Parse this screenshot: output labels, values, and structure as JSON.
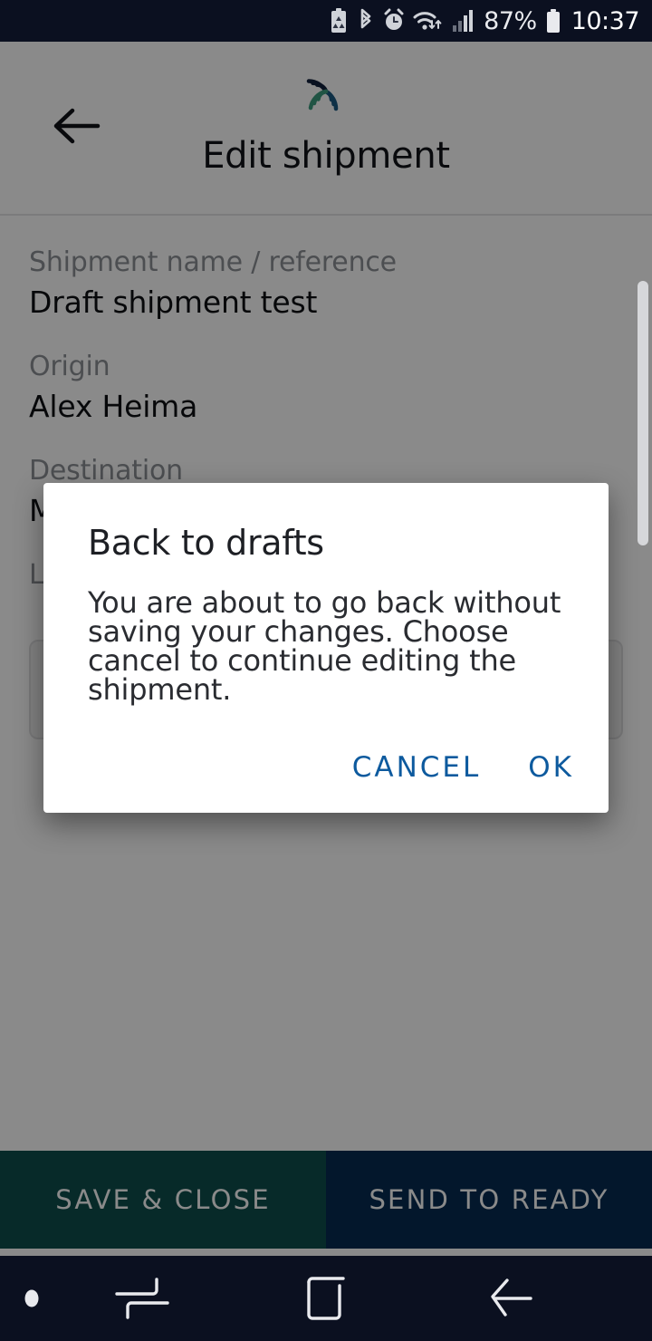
{
  "statusbar": {
    "icons": [
      "battery-saver-icon",
      "bluetooth-icon",
      "alarm-icon",
      "wifi-icon",
      "cellular-signal-icon",
      "battery-icon"
    ],
    "battery_percent": "87%",
    "time": "10:37"
  },
  "appbar": {
    "back_icon": "back-arrow-icon",
    "logo_icon": "app-logo-icon",
    "title": "Edit shipment",
    "logo_colors": {
      "navy": "#12203c",
      "blue": "#1b5a82",
      "green": "#3c9b7e"
    }
  },
  "form": {
    "fields": [
      {
        "label": "Shipment name / reference",
        "value": "Draft shipment test"
      },
      {
        "label": "Origin",
        "value": "Alex Heima"
      },
      {
        "label": "Destination",
        "value": "M"
      },
      {
        "label": "L",
        "value": ""
      }
    ]
  },
  "dialog": {
    "title": "Back to drafts",
    "message": "You are about to go back without saving your changes. Choose cancel to continue editing the shipment.",
    "cancel_label": "CANCEL",
    "ok_label": "OK",
    "action_color": "#0d5a9e"
  },
  "actionbar": {
    "save_label": "SAVE & CLOSE",
    "send_label": "SEND TO READY",
    "save_color": "#0d4f4c",
    "send_color": "#062c52"
  },
  "navbar": {
    "dot_icon": "notification-dot-icon",
    "recents_icon": "recent-apps-icon",
    "home_icon": "home-icon",
    "back_icon": "nav-back-icon"
  }
}
